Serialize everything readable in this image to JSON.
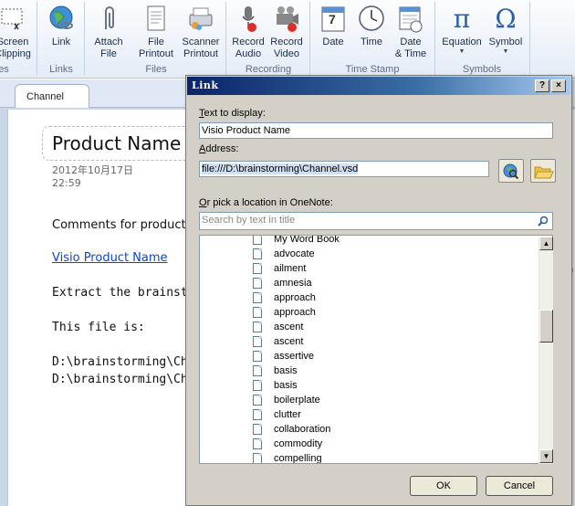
{
  "ribbon": {
    "buttons": {
      "screen_clipping": "Screen\nClipping",
      "link": "Link",
      "attach_file": "Attach\nFile",
      "file_printout": "File\nPrintout",
      "scanner_printout": "Scanner\nPrintout",
      "record_audio": "Record\nAudio",
      "record_video": "Record\nVideo",
      "date": "Date",
      "time": "Time",
      "date_time": "Date\n& Time",
      "equation": "Equation",
      "symbol": "Symbol"
    },
    "groups": {
      "images_partial": "es",
      "links": "Links",
      "files": "Files",
      "recording": "Recording",
      "time_stamp": "Time Stamp",
      "symbols": "Symbols"
    },
    "icons": {
      "equation_glyph": "π",
      "symbol_glyph": "Ω",
      "date_day": "7"
    }
  },
  "page": {
    "tab": "Channel",
    "title": "Product Name",
    "date": "2012年10月17日",
    "time": "22:59",
    "comments": "Comments for product n",
    "link_text": "Visio Product Name",
    "extract": "Extract the brainsto",
    "this_file": "This file is:",
    "path1": "D:\\brainstorming\\Cha",
    "path2": "D:\\brainstorming\\Ch"
  },
  "right_strip": [
    "n",
    "r",
    "t",
    "e",
    "gin",
    "e",
    "a",
    "t",
    "a"
  ],
  "dialog": {
    "title": "Link",
    "help_btn": "?",
    "close_btn": "×",
    "text_label_u": "T",
    "text_label_rest": "ext to display:",
    "text_value": "Visio Product Name",
    "address_label_u": "A",
    "address_label_rest": "ddress:",
    "address_value": "file:///D:\\brainstorming\\Channel.vsd",
    "pick_label_u": "O",
    "pick_label_rest": "r pick a location in OneNote:",
    "search_placeholder": "Search by text in title",
    "tree_items": [
      "My Word Book",
      "advocate",
      "ailment",
      "amnesia",
      "approach",
      "approach",
      "ascent",
      "ascent",
      "assertive",
      "basis",
      "basis",
      "boilerplate",
      "clutter",
      "collaboration",
      "commodity",
      "compelling"
    ],
    "ok": "OK",
    "cancel": "Cancel"
  },
  "colors": {
    "titlebar_start": "#0a246a",
    "link_blue": "#0a47c8",
    "dialog_face": "#d4d0c8"
  }
}
